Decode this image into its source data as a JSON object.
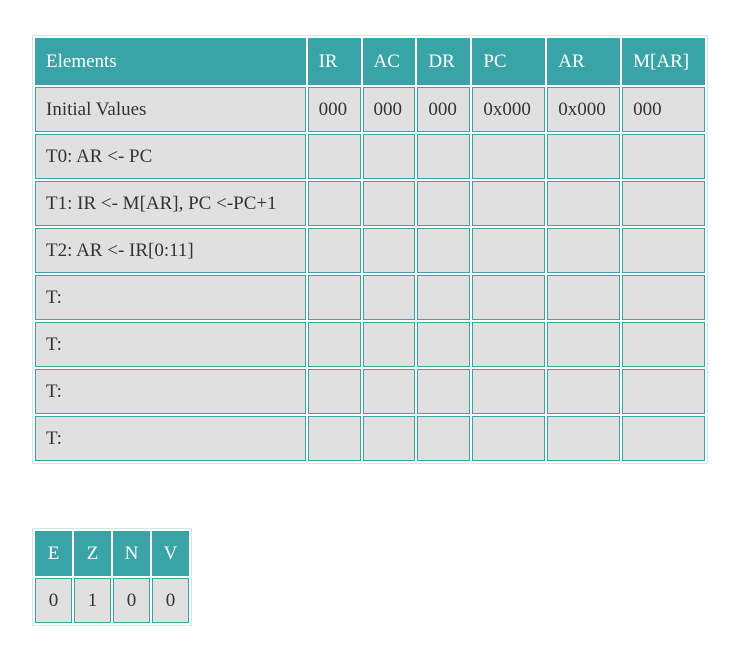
{
  "register_table": {
    "headers": [
      "Elements",
      "IR",
      "AC",
      "DR",
      "PC",
      "AR",
      "M[AR]"
    ],
    "rows": [
      {
        "label": "Initial Values",
        "values": [
          "000",
          "000",
          "000",
          "0x000",
          "0x000",
          "000"
        ]
      },
      {
        "label": "T0: AR <- PC",
        "values": [
          "",
          "",
          "",
          "",
          "",
          ""
        ]
      },
      {
        "label": "T1: IR <- M[AR], PC <-PC+1",
        "values": [
          "",
          "",
          "",
          "",
          "",
          ""
        ]
      },
      {
        "label": "T2: AR <- IR[0:11]",
        "values": [
          "",
          "",
          "",
          "",
          "",
          ""
        ]
      },
      {
        "label": "T:",
        "values": [
          "",
          "",
          "",
          "",
          "",
          ""
        ]
      },
      {
        "label": "T:",
        "values": [
          "",
          "",
          "",
          "",
          "",
          ""
        ]
      },
      {
        "label": "T:",
        "values": [
          "",
          "",
          "",
          "",
          "",
          ""
        ]
      },
      {
        "label": "T:",
        "values": [
          "",
          "",
          "",
          "",
          "",
          ""
        ]
      }
    ]
  },
  "flags_table": {
    "headers": [
      "E",
      "Z",
      "N",
      "V"
    ],
    "values": [
      "0",
      "1",
      "0",
      "0"
    ]
  },
  "colors": {
    "header_bg": "#3aa3a6",
    "cell_bg": "#e0e0e0",
    "border": "#3aa3a6"
  }
}
